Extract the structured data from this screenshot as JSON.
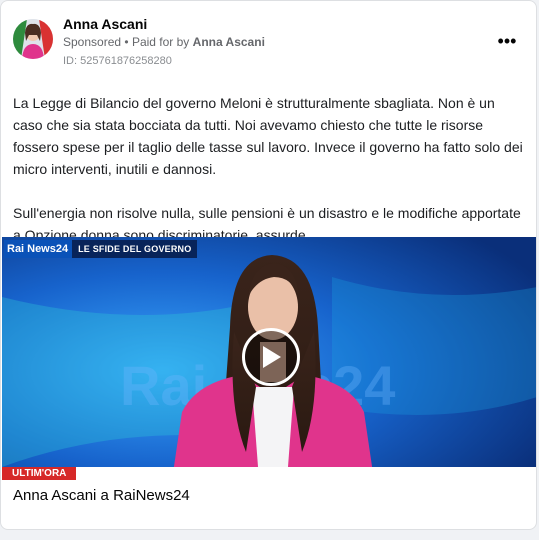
{
  "post": {
    "author": "Anna Ascani",
    "sponsored": "Sponsored",
    "separator": "•",
    "paid_for_prefix": "Paid for by",
    "paid_for_name": "Anna Ascani",
    "ad_id": "ID: 525761876258280",
    "more_icon_label": "•••",
    "paragraphs": [
      "La Legge di Bilancio del governo Meloni è strutturalmente sbagliata. Non è un caso che sia stata bocciata da tutti. Noi avevamo chiesto che tutte le risorse fossero spese per il taglio delle tasse sul lavoro. Invece il governo ha fatto solo dei micro interventi, inutili e dannosi.",
      "Sull'energia non risolve nulla, sulle pensioni è un disastro e le modifiche apportate a Opzione donna sono discriminatorie, assurde.…"
    ]
  },
  "video": {
    "logo_rai": "Rai",
    "logo_news24": "News24",
    "show_title": "LE SFIDE DEL GOVERNO",
    "ticker_tag": "ULTIM'ORA",
    "background_watermark": "Rai News24",
    "caption": "Anna Ascani a RaiNews24",
    "play_icon": "play-icon"
  },
  "colors": {
    "card_bg": "#ffffff",
    "page_bg": "#f0f2f5",
    "meta_text": "#65676b",
    "rai_blue": "#0a52b8",
    "ticker_red": "#d62828",
    "jacket_pink": "#e0348c"
  }
}
